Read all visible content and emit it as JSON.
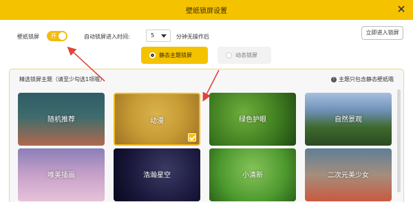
{
  "window": {
    "title": "壁纸锁屏设置",
    "close_icon": "close-icon"
  },
  "settings": {
    "lock_label": "壁纸锁屏",
    "toggle_text": "开",
    "toggle_on": true,
    "auto_label": "自动锁屏进入时间:",
    "auto_value": "5",
    "auto_suffix": "分钟无操作后",
    "enter_lock_button": "立即进入锁屏"
  },
  "modes": {
    "static_label": "静态主题锁屏",
    "dynamic_label": "动态锁屏",
    "selected": "static"
  },
  "panel": {
    "title": "精选锁屏主题（请至少勾选1项哦）",
    "hint": "主题只包含静态壁纸哦",
    "tiles": [
      {
        "label": "随机推荐"
      },
      {
        "label": "动漫",
        "checked": true
      },
      {
        "label": "绿色护眼"
      },
      {
        "label": "自然景观"
      },
      {
        "label": "唯美插画"
      },
      {
        "label": "浩瀚星空"
      },
      {
        "label": "小清新"
      },
      {
        "label": "二次元美少女"
      }
    ]
  },
  "colors": {
    "accent": "#f5c200",
    "annotation_arrow": "#e0443a"
  }
}
